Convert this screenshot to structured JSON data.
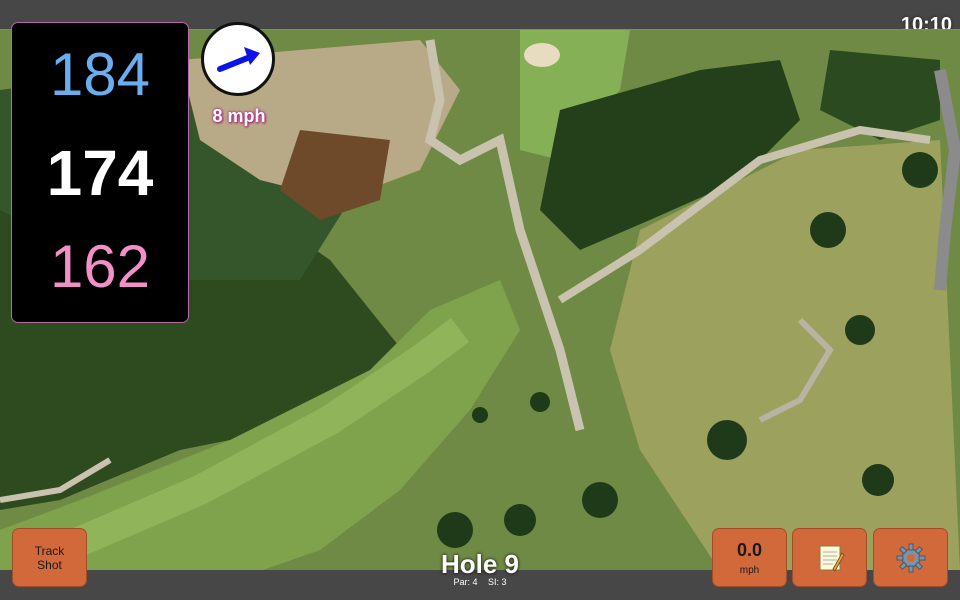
{
  "clock": "10:10",
  "distances": {
    "back": "184",
    "middle": "174",
    "front": "162"
  },
  "wind": {
    "speed_label": "8 mph",
    "direction_icon": "arrow-icon"
  },
  "buttons": {
    "track_shot": "Track\nShot",
    "speed_value": "0.0",
    "speed_unit": "mph",
    "notes_icon": "notepad-icon",
    "settings_icon": "gear-icon"
  },
  "hole": {
    "title": "Hole 9",
    "par": "Par: 4",
    "si": "SI: 3"
  },
  "colors": {
    "back_distance": "#6aaef0",
    "middle_distance": "#ffffff",
    "front_distance": "#f290c8",
    "button": "#d2693a",
    "panel_border": "#b66aa8"
  }
}
